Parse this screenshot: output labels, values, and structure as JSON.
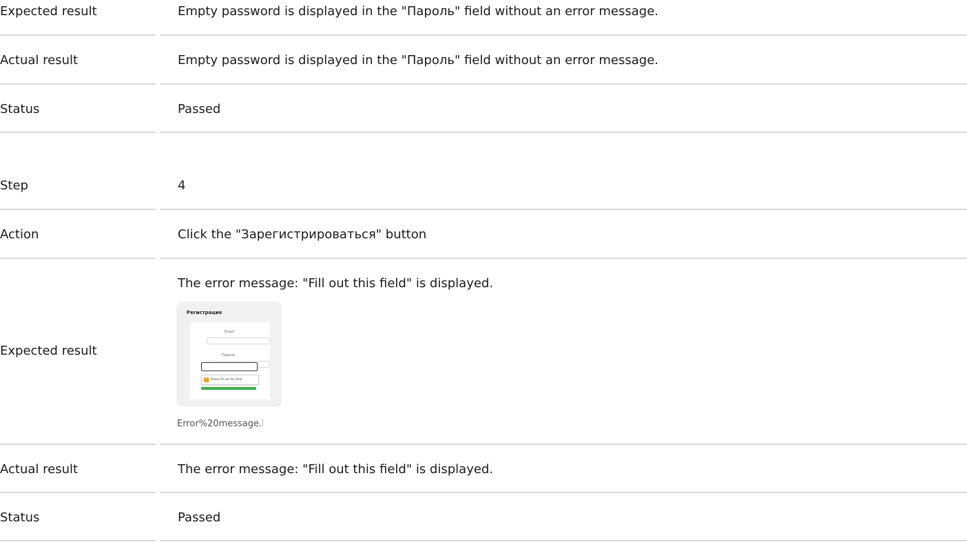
{
  "rows_top": {
    "expected_result_1": {
      "label": "Expected result",
      "value": "Empty password is displayed in the \"Пароль\" field without an error message."
    },
    "actual_result_1": {
      "label": "Actual result",
      "value": "Empty password is displayed in the \"Пароль\" field without an error message."
    },
    "status_1": {
      "label": "Status",
      "value": "Passed"
    }
  },
  "step_4": {
    "step": {
      "label": "Step",
      "value": "4"
    },
    "action": {
      "label": "Action",
      "value": "Click the \"Зарегистрироваться\" button"
    },
    "expected_result": {
      "label": "Expected result",
      "value": "The error message: \"Fill out this field\" is displayed.",
      "image_caption": "Error%20message."
    },
    "actual_result": {
      "label": "Actual result",
      "value": "The error message: \"Fill out this field\" is displayed."
    },
    "status": {
      "label": "Status",
      "value": "Passed"
    }
  },
  "thumbnail": {
    "title": "Регистрация",
    "email_label": "Email",
    "password_label": "Пароль",
    "tooltip_text": "Please fill out this field."
  },
  "colors": {
    "divider": "#d9d9d9",
    "tooltip_icon": "#f39c12",
    "submit_bar": "#3cae4a"
  }
}
